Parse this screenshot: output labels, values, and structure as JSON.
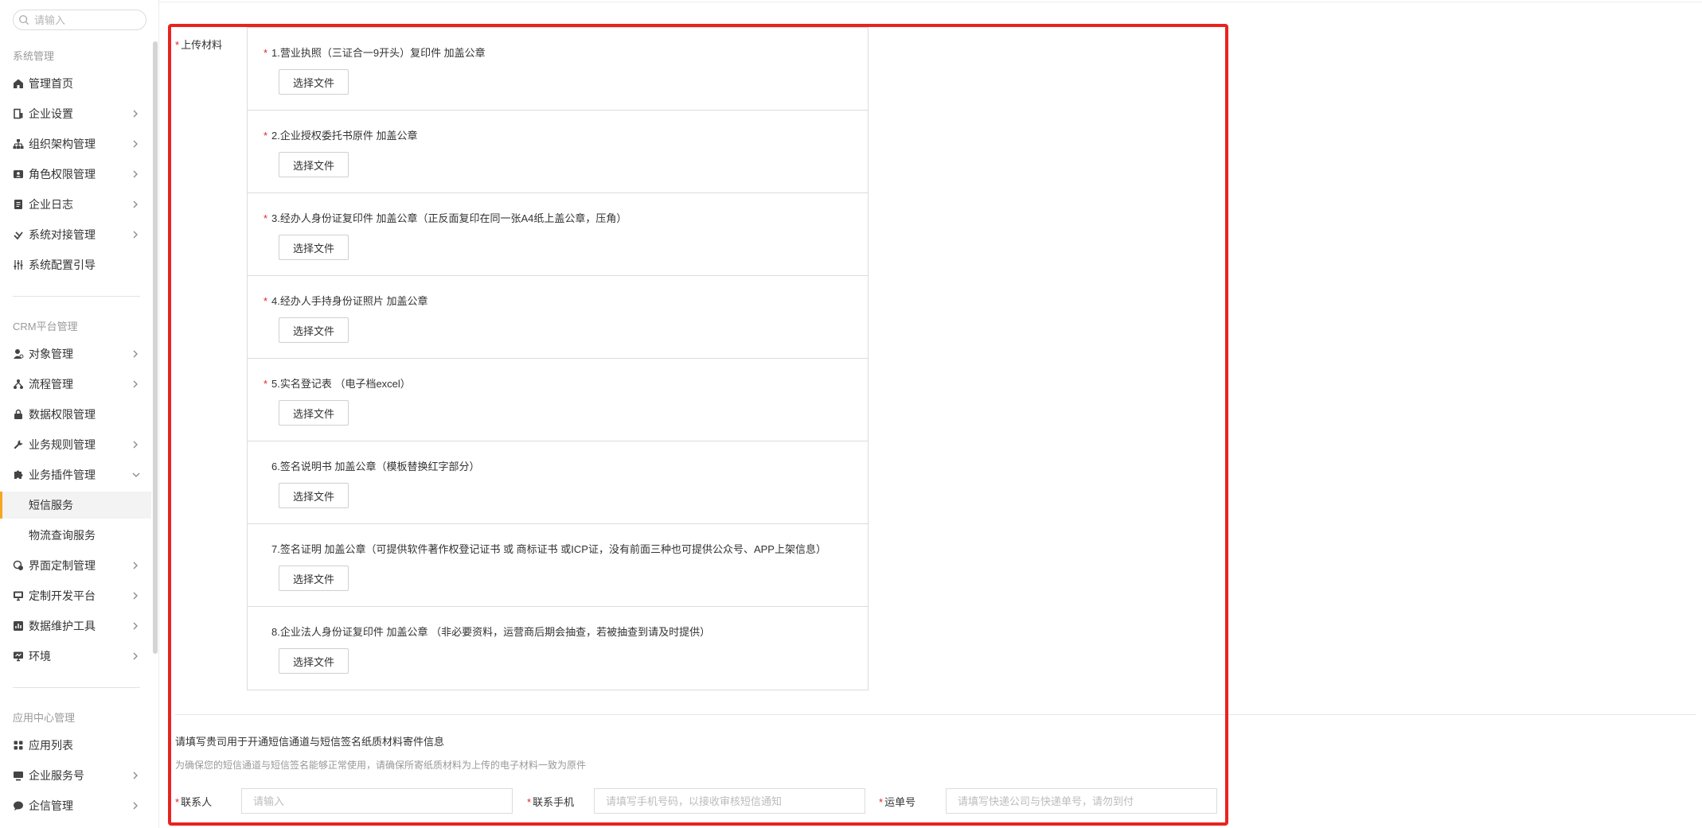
{
  "sidebar": {
    "search_placeholder": "请输入",
    "groups": {
      "system": "系统管理",
      "crm": "CRM平台管理",
      "app_center": "应用中心管理"
    },
    "items": {
      "home": "管理首页",
      "company_settings": "企业设置",
      "org": "组织架构管理",
      "roles": "角色权限管理",
      "logs": "企业日志",
      "integration": "系统对接管理",
      "config_guide": "系统配置引导",
      "objects": "对象管理",
      "workflow": "流程管理",
      "data_perm": "数据权限管理",
      "biz_rules": "业务规则管理",
      "biz_plugins": "业务插件管理",
      "sms": "短信服务",
      "logistics": "物流查询服务",
      "ui_custom": "界面定制管理",
      "dev_platform": "定制开发平台",
      "data_tools": "数据维护工具",
      "env": "环境",
      "app_list": "应用列表",
      "service_account": "企业服务号",
      "messaging": "企信管理"
    }
  },
  "upload": {
    "label": "上传材料",
    "button_label": "选择文件",
    "items": [
      {
        "required": true,
        "title": "1.营业执照（三证合一9开头）复印件 加盖公章"
      },
      {
        "required": true,
        "title": "2.企业授权委托书原件 加盖公章"
      },
      {
        "required": true,
        "title": "3.经办人身份证复印件 加盖公章（正反面复印在同一张A4纸上盖公章，压角）"
      },
      {
        "required": true,
        "title": "4.经办人手持身份证照片 加盖公章"
      },
      {
        "required": true,
        "title": "5.实名登记表 （电子档excel）"
      },
      {
        "required": false,
        "title": "6.签名说明书 加盖公章（模板替换红字部分）"
      },
      {
        "required": false,
        "title": "7.签名证明 加盖公章（可提供软件著作权登记证书 或 商标证书 或ICP证，没有前面三种也可提供公众号、APP上架信息）"
      },
      {
        "required": false,
        "title": "8.企业法人身份证复印件 加盖公章 （非必要资料，运营商后期会抽查，若被抽查到请及时提供）"
      }
    ]
  },
  "mail_info": {
    "title": "请填写贵司用于开通短信通道与短信签名纸质材料寄件信息",
    "subtitle": "为确保您的短信通道与短信签名能够正常使用，请确保所寄纸质材料为上传的电子材料一致为原件",
    "contact_label": "联系人",
    "contact_placeholder": "请输入",
    "phone_label": "联系手机",
    "phone_placeholder": "请填写手机号码，以接收审核短信通知",
    "tracking_label": "运单号",
    "tracking_placeholder": "请填写快递公司与快递单号，请勿到付"
  },
  "colors": {
    "required": "#e8231f",
    "highlight_border": "#e8231f",
    "active_accent": "#f6a623"
  }
}
